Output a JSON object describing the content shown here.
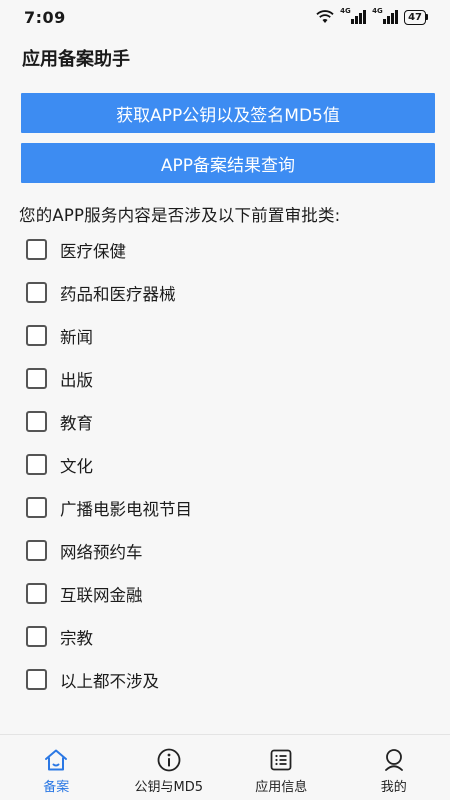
{
  "status_bar": {
    "time": "7:09",
    "signal1_tag": "4G",
    "signal2_tag": "4G",
    "battery": "47"
  },
  "app_title": "应用备案助手",
  "buttons": {
    "md5_label": "获取APP公钥以及签名MD5值",
    "query_label": "APP备案结果查询"
  },
  "question": "您的APP服务内容是否涉及以下前置审批类:",
  "options": [
    {
      "label": "医疗保健",
      "checked": false
    },
    {
      "label": "药品和医疗器械",
      "checked": false
    },
    {
      "label": "新闻",
      "checked": false
    },
    {
      "label": "出版",
      "checked": false
    },
    {
      "label": "教育",
      "checked": false
    },
    {
      "label": "文化",
      "checked": false
    },
    {
      "label": "广播电影电视节目",
      "checked": false
    },
    {
      "label": "网络预约车",
      "checked": false
    },
    {
      "label": "互联网金融",
      "checked": false
    },
    {
      "label": "宗教",
      "checked": false
    },
    {
      "label": "以上都不涉及",
      "checked": false
    }
  ],
  "bottom_nav": [
    {
      "label": "备案",
      "icon": "home-icon",
      "active": true
    },
    {
      "label": "公钥与MD5",
      "icon": "info-icon",
      "active": false
    },
    {
      "label": "应用信息",
      "icon": "list-icon",
      "active": false
    },
    {
      "label": "我的",
      "icon": "user-icon",
      "active": false
    }
  ],
  "colors": {
    "primary": "#3d8cf2",
    "nav_active": "#2b78e4",
    "background": "#f7f7f7"
  }
}
